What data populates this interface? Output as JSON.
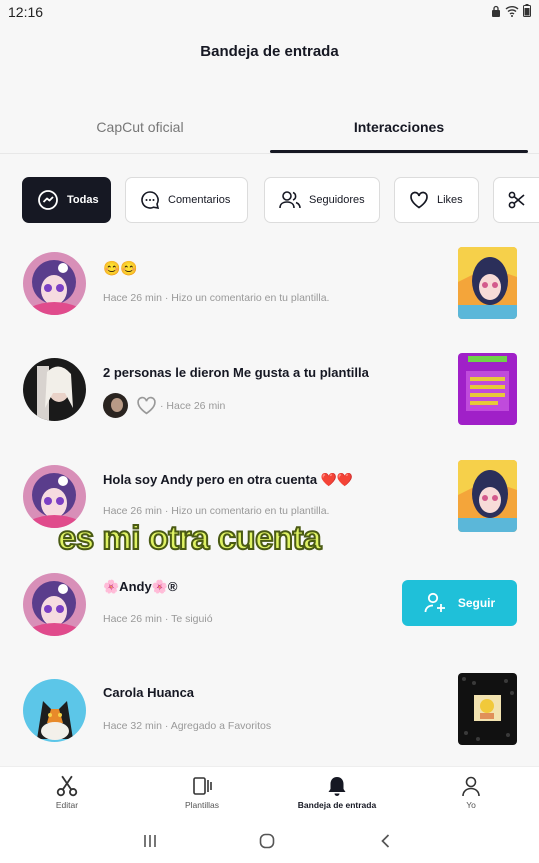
{
  "status": {
    "time": "12:16"
  },
  "header": {
    "title": "Bandeja de entrada"
  },
  "tabs": [
    {
      "label": "CapCut oficial"
    },
    {
      "label": "Interacciones"
    }
  ],
  "filters": [
    {
      "label": "Todas",
      "icon": "messenger-icon"
    },
    {
      "label": "Comentarios",
      "icon": "comment-icon"
    },
    {
      "label": "Seguidores",
      "icon": "followers-icon"
    },
    {
      "label": "Likes",
      "icon": "heart-icon"
    },
    {
      "label": "",
      "icon": "scissors-icon"
    }
  ],
  "notifications": [
    {
      "title": "😊😊",
      "meta": "Hace 26 min · Hizo un comentario en tu plantilla."
    },
    {
      "title": "2 personas le dieron Me gusta a tu plantilla",
      "meta": "· Hace 26 min"
    },
    {
      "title": "Hola soy Andy pero en otra cuenta ❤️❤️",
      "meta": "Hace 26 min · Hizo un comentario en tu plantilla."
    },
    {
      "title": "🌸Andy🌸®",
      "meta": "Hace 26 min · Te siguió",
      "button": "Seguir"
    },
    {
      "title": "Carola Huanca",
      "meta": "Hace 32 min · Agregado a Favoritos"
    }
  ],
  "overlay": {
    "caption": "es mi otra cuenta"
  },
  "bottom_nav": [
    {
      "label": "Editar",
      "icon": "scissors-icon"
    },
    {
      "label": "Plantillas",
      "icon": "templates-icon"
    },
    {
      "label": "Bandeja de entrada",
      "icon": "bell-icon"
    },
    {
      "label": "Yo",
      "icon": "person-icon"
    }
  ],
  "colors": {
    "accent": "#1fc0d9",
    "dark": "#161823",
    "caption": "#dff264"
  }
}
